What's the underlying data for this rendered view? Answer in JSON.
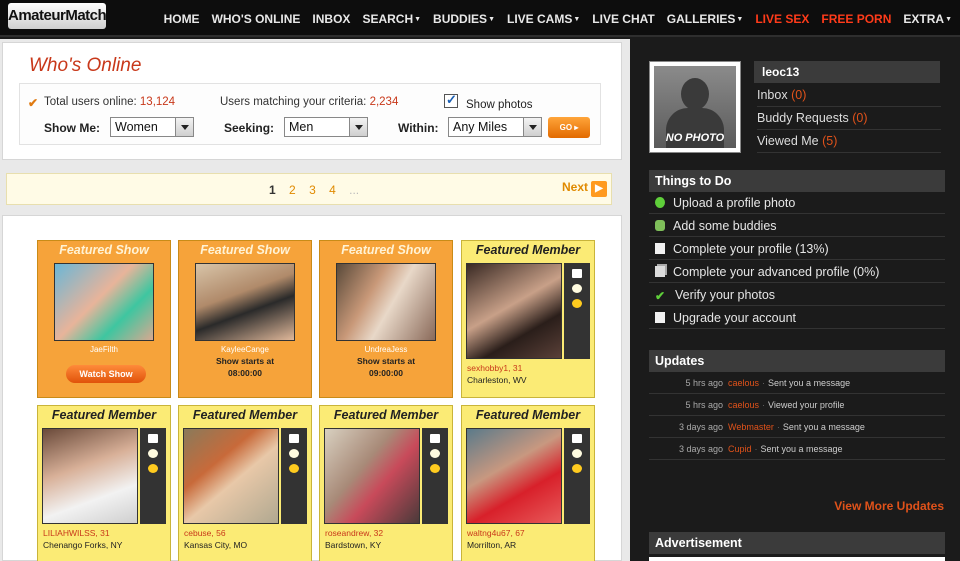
{
  "header": {
    "logo": "AmateurMatch",
    "nav": [
      {
        "label": "HOME",
        "caret": false,
        "hot": false
      },
      {
        "label": "WHO'S ONLINE",
        "caret": false,
        "hot": false
      },
      {
        "label": "INBOX",
        "caret": false,
        "hot": false
      },
      {
        "label": "SEARCH",
        "caret": true,
        "hot": false
      },
      {
        "label": "BUDDIES",
        "caret": true,
        "hot": false
      },
      {
        "label": "LIVE CAMS",
        "caret": true,
        "hot": false
      },
      {
        "label": "LIVE CHAT",
        "caret": false,
        "hot": false
      },
      {
        "label": "GALLERIES",
        "caret": true,
        "hot": false
      },
      {
        "label": "LIVE SEX",
        "caret": false,
        "hot": true
      },
      {
        "label": "FREE PORN",
        "caret": false,
        "hot": true
      },
      {
        "label": "EXTRA",
        "caret": true,
        "hot": false
      }
    ]
  },
  "search": {
    "title": "Who's Online",
    "total_label": "Total users online:",
    "total_value": "13,124",
    "matching_label": "Users matching your criteria:",
    "matching_value": "2,234",
    "show_photos_label": "Show photos",
    "show_photos_checked": true,
    "show_me_label": "Show Me:",
    "show_me_value": "Women",
    "seeking_label": "Seeking:",
    "seeking_value": "Men",
    "within_label": "Within:",
    "within_value": "Any Miles",
    "go_label": "GO ▸"
  },
  "pager": {
    "pages": [
      "1",
      "2",
      "3",
      "4"
    ],
    "current": "1",
    "ellipsis": "...",
    "next_label": "Next"
  },
  "cards": [
    {
      "type": "show",
      "title": "Featured Show",
      "name": "JaeFilth",
      "button": "Watch Show"
    },
    {
      "type": "show",
      "title": "Featured Show",
      "name": "KayleeCange",
      "time_line1": "Show starts at",
      "time_line2": "08:00:00"
    },
    {
      "type": "show",
      "title": "Featured Show",
      "name": "UndreaJess",
      "time_line1": "Show starts at",
      "time_line2": "09:00:00"
    },
    {
      "type": "member",
      "title": "Featured Member",
      "name": "sexhobby1, 31",
      "location": "Charleston, WV"
    },
    {
      "type": "member",
      "title": "Featured Member",
      "name": "LILIAHWILSS, 31",
      "location": "Chenango Forks, NY"
    },
    {
      "type": "member",
      "title": "Featured Member",
      "name": "cebuse, 56",
      "location": "Kansas City, MO"
    },
    {
      "type": "member",
      "title": "Featured Member",
      "name": "roseandrew, 32",
      "location": "Bardstown, KY"
    },
    {
      "type": "member",
      "title": "Featured Member",
      "name": "waltng4u67, 67",
      "location": "Morrilton, AR"
    }
  ],
  "profile": {
    "no_photo": "NO PHOTO",
    "username": "leoc13",
    "links": [
      {
        "label": "Inbox",
        "count": "(0)"
      },
      {
        "label": "Buddy Requests",
        "count": "(0)"
      },
      {
        "label": "Viewed Me",
        "count": "(5)"
      }
    ]
  },
  "todo": {
    "title": "Things to Do",
    "items": [
      {
        "label": "Upload a profile photo",
        "icon": "upload-icon"
      },
      {
        "label": "Add some buddies",
        "icon": "buddies-icon"
      },
      {
        "label": "Complete your profile (13%)",
        "icon": "document-icon"
      },
      {
        "label": "Complete your advanced profile (0%)",
        "icon": "documents-icon"
      },
      {
        "label": "Verify your photos",
        "icon": "checkmark-icon"
      },
      {
        "label": "Upgrade your account",
        "icon": "document-icon"
      }
    ]
  },
  "updates": {
    "title": "Updates",
    "items": [
      {
        "time": "5 hrs ago",
        "user": "caelous",
        "text": "Sent you a message"
      },
      {
        "time": "5 hrs ago",
        "user": "caelous",
        "text": "Viewed your profile"
      },
      {
        "time": "3 days ago",
        "user": "Webmaster",
        "text": "Sent you a message"
      },
      {
        "time": "3 days ago",
        "user": "Cupid",
        "text": "Sent you a message"
      }
    ],
    "more_label": "View More Updates"
  },
  "advertisement": {
    "title": "Advertisement"
  },
  "colors": {
    "accent": "#ff8a1f",
    "brand_red": "#c8381a",
    "hot_nav": "#ff3b1a"
  }
}
